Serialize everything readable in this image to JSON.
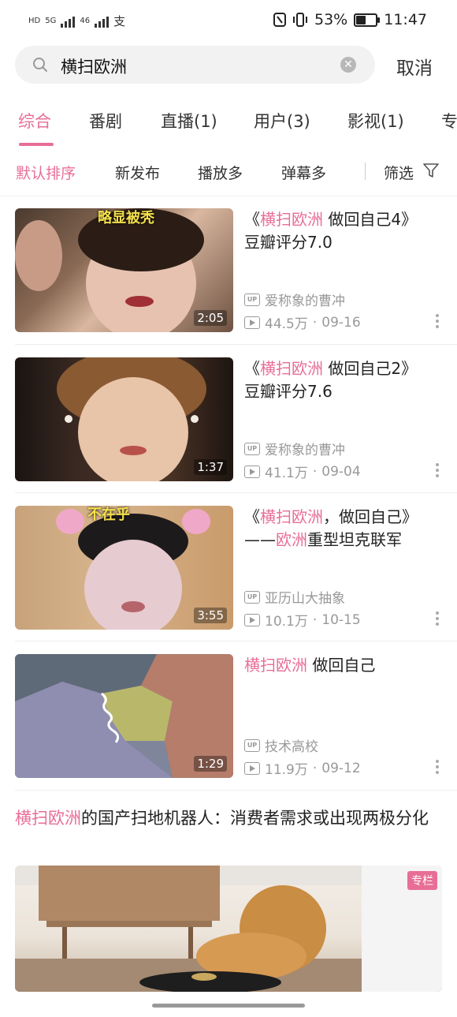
{
  "status_bar": {
    "left_labels": [
      "HD",
      "5G",
      "46"
    ],
    "pay_icon": "支",
    "battery": "53%",
    "battery_level": 0.53,
    "time": "11:47"
  },
  "search": {
    "query": "横扫欧洲",
    "cancel_label": "取消"
  },
  "tabs": [
    {
      "label": "综合",
      "active": true
    },
    {
      "label": "番剧",
      "active": false
    },
    {
      "label": "直播(1)",
      "active": false
    },
    {
      "label": "用户(3)",
      "active": false
    },
    {
      "label": "影视(1)",
      "active": false
    },
    {
      "label": "专",
      "active": false
    }
  ],
  "sort": {
    "options": [
      "默认排序",
      "新发布",
      "播放多",
      "弹幕多"
    ],
    "filter_label": "筛选"
  },
  "results": [
    {
      "title_prefix": "《",
      "title_hl": "横扫欧洲",
      "title_rest": " 做回自己4》",
      "title_line2": "豆瓣评分7.0",
      "duration": "2:05",
      "thumb_caption": "略显被秃",
      "author": "爱称象的曹冲",
      "views": "44.5万",
      "date": "09-16"
    },
    {
      "title_prefix": "《",
      "title_hl": "横扫欧洲",
      "title_rest": " 做回自己2》",
      "title_line2": "豆瓣评分7.6",
      "duration": "1:37",
      "author": "爱称象的曹冲",
      "views": "41.1万",
      "date": "09-04"
    },
    {
      "title_prefix": "《",
      "title_hl": "横扫欧洲",
      "title_rest": "，做回自己》",
      "title_line2_prefix": "——",
      "title_line2_hl": "欧洲",
      "title_line2_rest": "重型坦克联军",
      "duration": "3:55",
      "thumb_caption": "不在乎",
      "author": "亚历山大抽象",
      "views": "10.1万",
      "date": "10-15"
    },
    {
      "title_prefix": "",
      "title_hl": "横扫欧洲",
      "title_rest": " 做回自己",
      "duration": "1:29",
      "author": "技术高校",
      "views": "11.9万",
      "date": "09-12"
    }
  ],
  "article": {
    "title_hl": "横扫欧洲",
    "title_rest": "的国产扫地机器人：消费者需求或出现两极分化",
    "badge": "专栏"
  },
  "up_label": "UP",
  "meta_sep": "·"
}
